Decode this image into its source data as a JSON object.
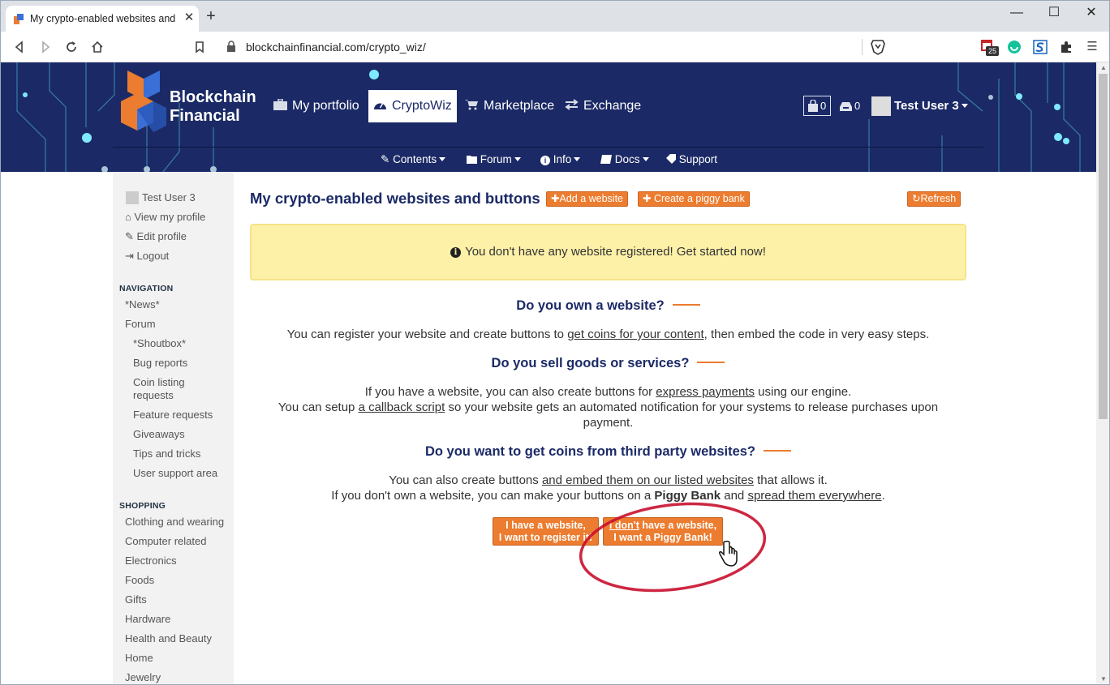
{
  "browser": {
    "tab_title": "My crypto-enabled websites and",
    "tab_close": "✕",
    "new_tab": "+",
    "url": "blockchainfinancial.com/crypto_wiz/",
    "window_controls": [
      "—",
      "☐",
      "✕"
    ],
    "extension_badge": "25"
  },
  "site": {
    "brand_line1": "Blockchain",
    "brand_line2": "Financial",
    "nav": [
      "My portfolio",
      "CryptoWiz",
      "Marketplace",
      "Exchange"
    ],
    "subnav": [
      "Contents",
      "Forum",
      "Info",
      "Docs",
      "Support"
    ],
    "cart_count": "0",
    "inbox_count": "0",
    "user_name": "Test User 3"
  },
  "sidebar": {
    "user": "Test User 3",
    "user_links": [
      "View my profile",
      "Edit profile",
      "Logout"
    ],
    "navigation_heading": "NAVIGATION",
    "navigation": [
      "*News*",
      "Forum"
    ],
    "forum_items": [
      "*Shoutbox*",
      "Bug reports",
      "Coin listing",
      "requests",
      "Feature requests",
      "Giveaways",
      "Tips and tricks",
      "User support area"
    ],
    "shopping_heading": "SHOPPING",
    "shopping": [
      "Clothing and wearing",
      "Computer related",
      "Electronics",
      "Foods",
      "Gifts",
      "Hardware",
      "Health and Beauty",
      "Home",
      "Jewelry"
    ]
  },
  "main": {
    "title": "My crypto-enabled websites and buttons",
    "add_website": "Add a website",
    "create_piggy": "Create a piggy bank",
    "refresh": "Refresh",
    "alert": "You don't have any website registered! Get started now!",
    "q1": "Do you own a website?",
    "p1_a": "You can register your website and create buttons to ",
    "p1_link": "get coins for your content",
    "p1_b": ", then embed the code in very easy steps.",
    "q2": "Do you sell goods or services?",
    "p2_a": "If you have a website, you can also create buttons for ",
    "p2_link": "express payments",
    "p2_b": " using our engine.",
    "p3_a": "You can setup ",
    "p3_link": "a callback script",
    "p3_b": " so your website gets an automated notification for your systems to release purchases upon payment.",
    "q3": "Do you want to get coins from third party websites?",
    "p4_a": "You can also create buttons ",
    "p4_link": "and embed them on our listed websites",
    "p4_b": " that allows it.",
    "p5_a": "If you don't own a website, you can make your buttons on a ",
    "p5_bold": "Piggy Bank",
    "p5_b": " and ",
    "p5_link": "spread them everywhere",
    "p5_c": ".",
    "btn1_line1": "I have a website,",
    "btn1_line2": "I want to register it!",
    "btn2_line1_u": "I don't",
    "btn2_line1_rest": " have a website,",
    "btn2_line2": "I want a Piggy Bank!"
  },
  "colors": {
    "header_bg": "#1b2a66",
    "accent_orange": "#ec7c2f",
    "alert_bg": "#fdf1a8",
    "annotation_red": "#c8102e"
  }
}
